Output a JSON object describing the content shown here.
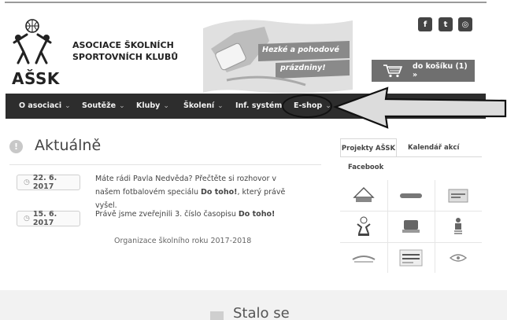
{
  "header": {
    "logo_text": "AŠSK",
    "org_name_line1": "ASOCIACE ŠKOLNÍCH",
    "org_name_line2": "SPORTOVNÍCH KLUBŮ",
    "banner_line1": "Hezké a pohodové",
    "banner_line2": "prázdniny!",
    "social": [
      {
        "icon": "facebook-icon",
        "glyph": "f"
      },
      {
        "icon": "twitter-icon",
        "glyph": "t"
      },
      {
        "icon": "instagram-icon",
        "glyph": "◎"
      }
    ],
    "cart_label": "do košíku (1) »"
  },
  "nav": {
    "items": [
      {
        "label": "O asociaci",
        "caret": "⌄"
      },
      {
        "label": "Soutěže",
        "caret": "⌄"
      },
      {
        "label": "Kluby",
        "caret": "⌄"
      },
      {
        "label": "Školení",
        "caret": "⌄"
      },
      {
        "label": "Inf. systém",
        "caret": ""
      },
      {
        "label": "E-shop",
        "caret": "⌄"
      }
    ]
  },
  "main": {
    "title": "Aktuálně",
    "news": [
      {
        "date": "22. 6. 2017",
        "text_before": "Máte rádi Pavla Nedvěda? Přečtěte si rozhovor v našem fotbalovém speciálu ",
        "text_bold": "Do toho!",
        "text_after": ", který právě vyšel."
      },
      {
        "date": "15. 6. 2017",
        "text_before": "Právě jsme zveřejnili 3. číslo časopisu ",
        "text_bold": "Do toho!",
        "text_after": ""
      }
    ],
    "extra_line": "Organizace školního roku 2017-2018"
  },
  "sidebar": {
    "tabs": [
      "Projekty AŠSK",
      "Kalendář akcí",
      "Facebook"
    ]
  },
  "footer": {
    "title": "Stalo se"
  },
  "colors": {
    "nav_bg": "#2d2d2d",
    "cart_bg": "#6f6f6f"
  }
}
